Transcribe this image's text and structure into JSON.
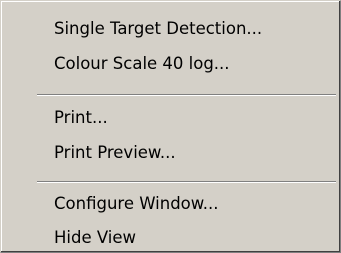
{
  "menu": {
    "groups": [
      {
        "items": [
          {
            "label": "Single Target Detection..."
          },
          {
            "label": "Colour Scale 40 log..."
          }
        ]
      },
      {
        "items": [
          {
            "label": "Print..."
          },
          {
            "label": "Print Preview..."
          }
        ]
      },
      {
        "items": [
          {
            "label": "Configure Window..."
          },
          {
            "label": "Hide View"
          }
        ]
      }
    ]
  }
}
